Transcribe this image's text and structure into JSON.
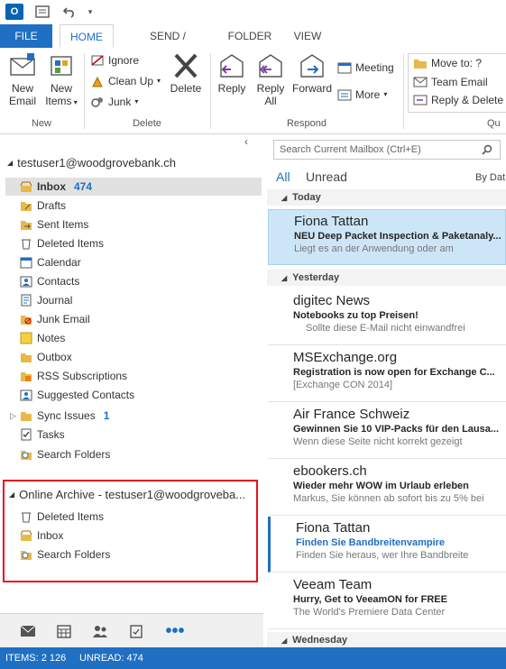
{
  "app": {
    "icon_label": "O"
  },
  "tabs": [
    "FILE",
    "HOME",
    "SEND / RECEIVE",
    "FOLDER",
    "VIEW"
  ],
  "ribbon": {
    "new_email": "New Email",
    "new_items": "New Items",
    "new_group": "New",
    "ignore": "Ignore",
    "clean_up": "Clean Up",
    "junk": "Junk",
    "delete": "Delete",
    "delete_group": "Delete",
    "reply": "Reply",
    "reply_all": "Reply All",
    "forward": "Forward",
    "meeting": "Meeting",
    "more": "More",
    "respond_group": "Respond",
    "move_to": "Move to: ?",
    "team_email": "Team Email",
    "reply_delete": "Reply & Delete",
    "quick_group": "Qu"
  },
  "folders": {
    "account": "testuser1@woodgrovebank.ch",
    "items": [
      {
        "label": "Inbox",
        "count": "474"
      },
      {
        "label": "Drafts",
        "count": ""
      },
      {
        "label": "Sent Items",
        "count": ""
      },
      {
        "label": "Deleted Items",
        "count": ""
      },
      {
        "label": "Calendar",
        "count": ""
      },
      {
        "label": "Contacts",
        "count": ""
      },
      {
        "label": "Journal",
        "count": ""
      },
      {
        "label": "Junk Email",
        "count": ""
      },
      {
        "label": "Notes",
        "count": ""
      },
      {
        "label": "Outbox",
        "count": ""
      },
      {
        "label": "RSS Subscriptions",
        "count": ""
      },
      {
        "label": "Suggested Contacts",
        "count": ""
      },
      {
        "label": "Sync Issues",
        "count": "1"
      },
      {
        "label": "Tasks",
        "count": ""
      },
      {
        "label": "Search Folders",
        "count": ""
      }
    ],
    "archive": {
      "title": "Online Archive - testuser1@woodgroveba...",
      "items": [
        "Deleted Items",
        "Inbox",
        "Search Folders"
      ]
    }
  },
  "messages": {
    "search_placeholder": "Search Current Mailbox (Ctrl+E)",
    "filter_all": "All",
    "filter_unread": "Unread",
    "sort_label": "By Dat",
    "groups": {
      "today": "Today",
      "yesterday": "Yesterday",
      "wednesday": "Wednesday"
    },
    "list": [
      {
        "sender": "Fiona Tattan",
        "subject": "NEU Deep Packet Inspection & Paketanaly...",
        "preview": "Liegt es an der Anwendung oder am"
      },
      {
        "sender": "digitec News",
        "subject": "Notebooks zu top Preisen!",
        "preview": "Sollte diese E-Mail nicht einwandfrei"
      },
      {
        "sender": "MSExchange.org",
        "subject": "Registration is now open for Exchange C...",
        "preview": "[Exchange CON 2014]"
      },
      {
        "sender": "Air France Schweiz",
        "subject": "Gewinnen Sie 10 VIP-Packs für den Lausa...",
        "preview": "Wenn diese Seite nicht korrekt gezeigt"
      },
      {
        "sender": "ebookers.ch",
        "subject": "Wieder mehr WOW im Urlaub erleben",
        "preview": "Markus, Sie können ab sofort bis zu 5% bei"
      },
      {
        "sender": "Fiona Tattan",
        "subject": "Finden Sie Bandbreitenvampire",
        "preview": "Finden Sie heraus, wer Ihre Bandbreite"
      },
      {
        "sender": "Veeam Team",
        "subject": "Hurry, Get to VeeamON for FREE",
        "preview": "The World's Premiere Data Center"
      }
    ]
  },
  "status": {
    "items": "ITEMS: 2 126",
    "unread": "UNREAD: 474"
  },
  "colors": {
    "accent": "#1f6fc3",
    "selected": "#cde6f7",
    "highlight_border": "#e81123"
  }
}
